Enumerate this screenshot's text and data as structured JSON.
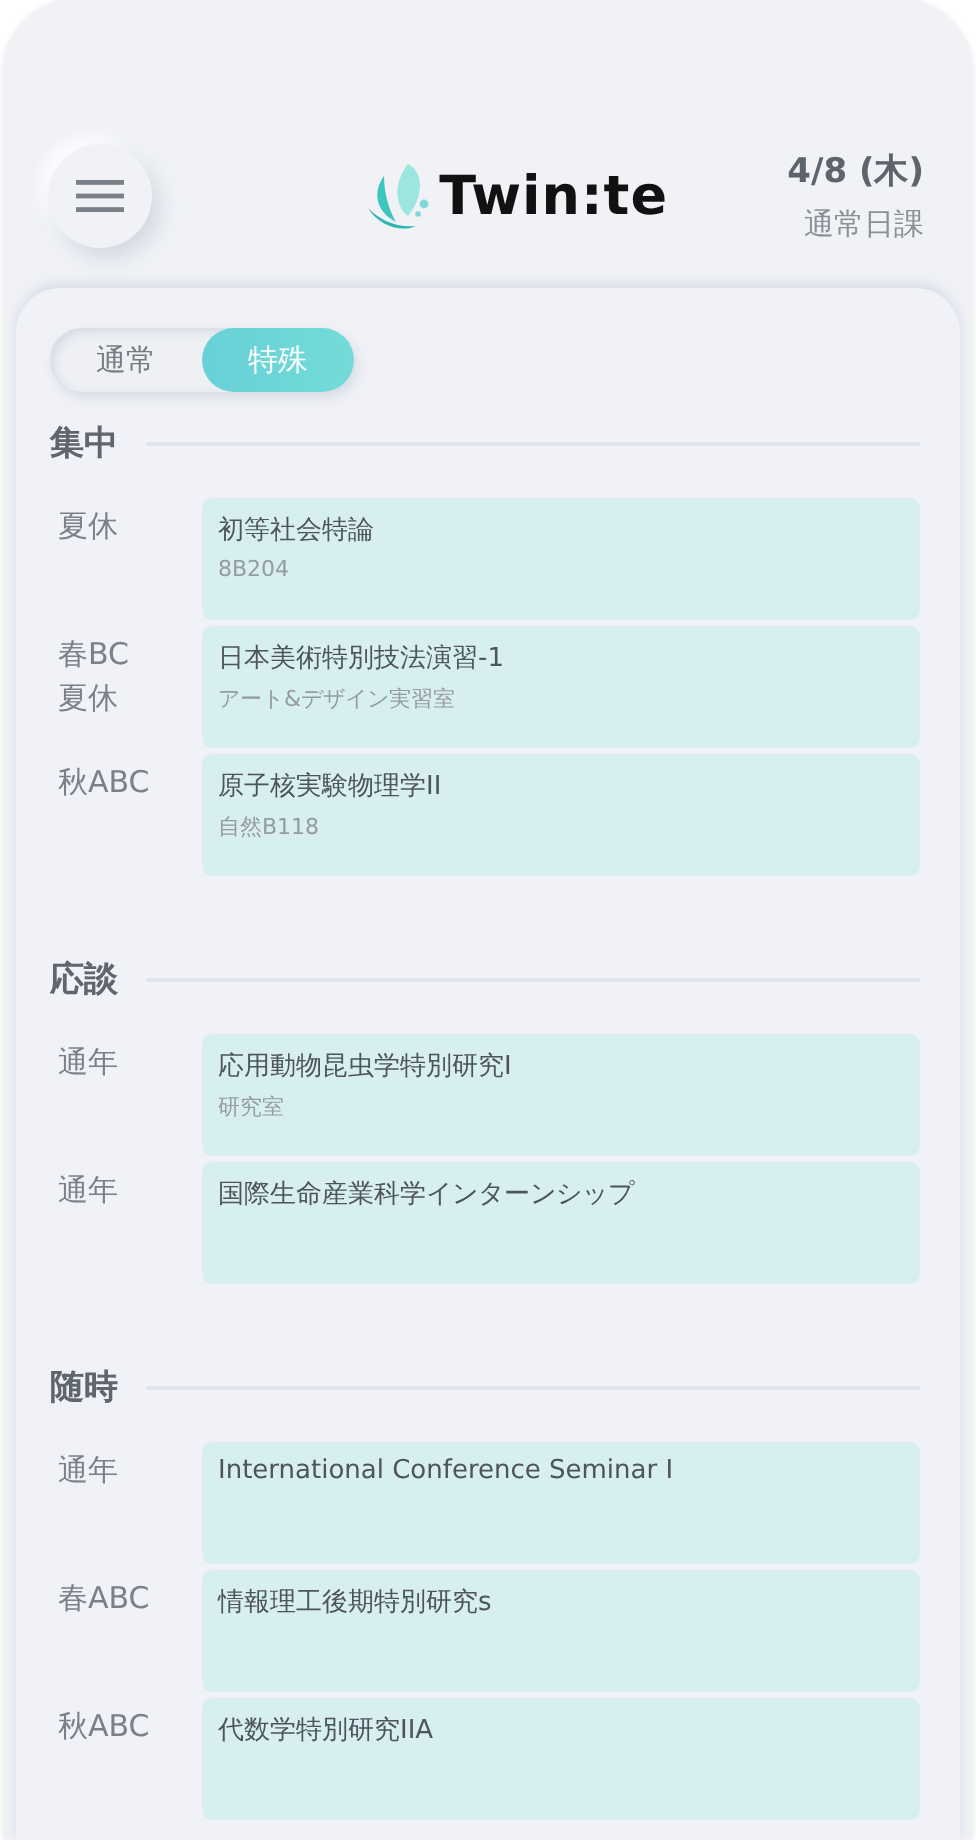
{
  "header": {
    "logo_text": "Twin:te",
    "date": "4/8 (木)",
    "schedule_type": "通常日課"
  },
  "mode_toggle": [
    {
      "label": "通常",
      "selected": false
    },
    {
      "label": "特殊",
      "selected": true
    }
  ],
  "sections": [
    {
      "title": "集中",
      "courses": [
        {
          "periods": [
            "夏休"
          ],
          "name": "初等社会特論",
          "room": "8B204"
        },
        {
          "periods": [
            "春BC",
            "夏休"
          ],
          "name": "日本美術特別技法演習-1",
          "room": "アート&デザイン実習室"
        },
        {
          "periods": [
            "秋ABC"
          ],
          "name": "原子核実験物理学II",
          "room": "自然B118"
        }
      ]
    },
    {
      "title": "応談",
      "courses": [
        {
          "periods": [
            "通年"
          ],
          "name": "応用動物昆虫学特別研究I",
          "room": "研究室"
        },
        {
          "periods": [
            "通年"
          ],
          "name": "国際生命産業科学インターンシップ"
        }
      ]
    },
    {
      "title": "随時",
      "courses": [
        {
          "periods": [
            "通年"
          ],
          "name": "International Conference Seminar I"
        },
        {
          "periods": [
            "春ABC"
          ],
          "name": "情報理工後期特別研究s"
        },
        {
          "periods": [
            "秋ABC"
          ],
          "name": "代数学特別研究IIA"
        }
      ]
    }
  ]
}
